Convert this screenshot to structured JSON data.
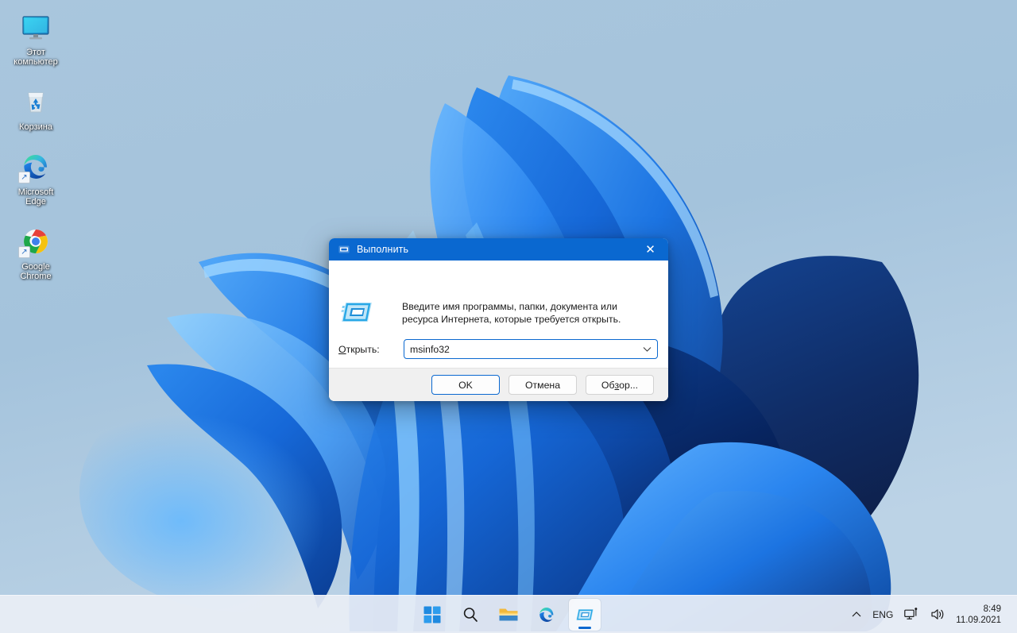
{
  "desktop": {
    "icons": [
      {
        "label": "Этот компьютер",
        "icon": "this-pc-icon",
        "shortcut": false
      },
      {
        "label": "Корзина",
        "icon": "recycle-bin-icon",
        "shortcut": false
      },
      {
        "label": "Microsoft Edge",
        "icon": "microsoft-edge-icon",
        "shortcut": true
      },
      {
        "label": "Google Chrome",
        "icon": "google-chrome-icon",
        "shortcut": true
      }
    ]
  },
  "run_dialog": {
    "title": "Выполнить",
    "title_icon": "run-icon",
    "close_label": "✕",
    "prompt": "Введите имя программы, папки, документа или ресурса Интернета, которые требуется открыть.",
    "open_label_prefix": "О",
    "open_label_rest": "ткрыть:",
    "open_value": "msinfo32",
    "open_placeholder": "",
    "dropdown_icon": "chevron-down-icon",
    "buttons": {
      "ok": "OK",
      "cancel": "Отмена",
      "browse_pre": "Об",
      "browse_accel": "з",
      "browse_post": "ор..."
    }
  },
  "taskbar": {
    "items": [
      {
        "name": "start-button",
        "label": "Пуск",
        "icon": "windows-logo-icon",
        "active": false
      },
      {
        "name": "search-button",
        "label": "Поиск",
        "icon": "search-icon",
        "active": false
      },
      {
        "name": "file-explorer-button",
        "label": "Проводник",
        "icon": "folder-icon",
        "active": false
      },
      {
        "name": "edge-button",
        "label": "Microsoft Edge",
        "icon": "microsoft-edge-icon",
        "active": false
      },
      {
        "name": "run-taskbar-button",
        "label": "Выполнить",
        "icon": "run-icon",
        "active": true
      }
    ],
    "tray": {
      "overflow_icon": "chevron-up-icon",
      "language": "ENG",
      "network_icon": "network-icon",
      "volume_icon": "volume-icon",
      "time": "8:49",
      "date": "11.09.2021"
    }
  },
  "colors": {
    "accent": "#0a68d0",
    "titlebar": "#0a68d0",
    "dialog_body": "#ffffff",
    "dialog_footer": "#f0f0f0",
    "taskbar": "#e9eef5",
    "wallpaper_sky": "#a9c6df"
  }
}
